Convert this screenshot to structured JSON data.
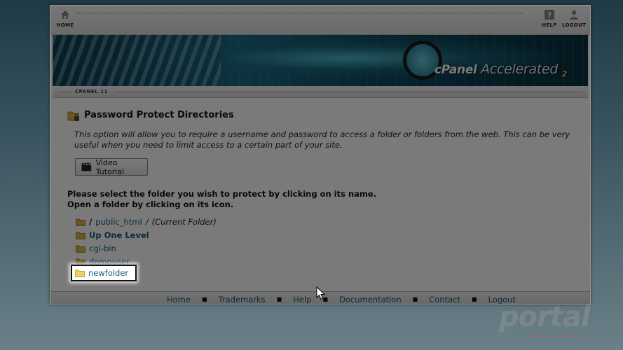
{
  "topbar": {
    "home_label": "HOME",
    "help_label": "HELP",
    "logout_label": "LOGOUT"
  },
  "banner": {
    "brand": "cPanel",
    "accelerated": "Accelerated",
    "version_mark": "2"
  },
  "crumb": "CPANEL 11",
  "page": {
    "title": "Password Protect Directories",
    "description": "This option will allow you to require a username and password to access a folder or folders from the web. This can be very useful when you need to limit access to a certain part of your site.",
    "video_button": "Video Tutorial",
    "instruction_line1": "Please select the folder you wish to protect by clicking on its name.",
    "instruction_line2": "Open a folder by clicking on its icon."
  },
  "folders": {
    "root_slash": "/",
    "current_path": "public_html",
    "path_sep": "/",
    "current_note": "(Current Folder)",
    "up_one": "Up One Level",
    "item1": "cgi-bin",
    "item2": "demouser",
    "item3": "newfolder"
  },
  "footer": {
    "home": "Home",
    "trademarks": "Trademarks",
    "help": "Help",
    "documentation": "Documentation",
    "contact": "Contact",
    "logout": "Logout",
    "separator": "■"
  },
  "watermark": {
    "main": "portal",
    "sub": "pro hosting"
  },
  "colors": {
    "link": "#1a5a7a",
    "folder": "#d9b640",
    "dim_overlay": "rgba(0,0,0,0.52)"
  }
}
